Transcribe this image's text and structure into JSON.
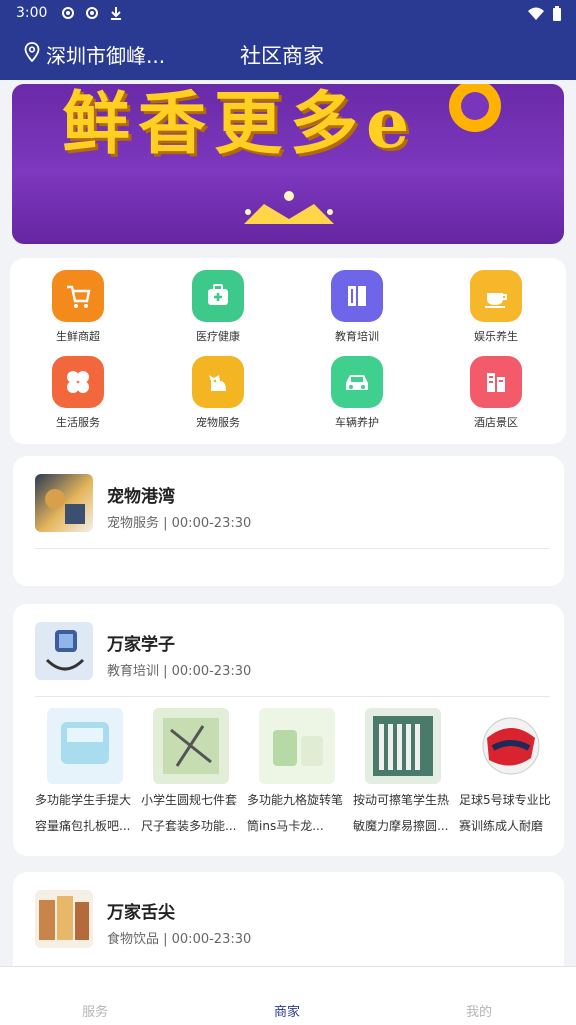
{
  "status": {
    "time": "3:00"
  },
  "header": {
    "location": "深圳市御峰...",
    "title": "社区商家"
  },
  "banner": {
    "text": "鲜香更多e"
  },
  "categories": [
    {
      "label": "生鲜商超",
      "icon": "shopping-cart-icon",
      "color": "#f48a1c"
    },
    {
      "label": "医疗健康",
      "icon": "medical-kit-icon",
      "color": "#3cc98a"
    },
    {
      "label": "教育培训",
      "icon": "book-icon",
      "color": "#6f65e8"
    },
    {
      "label": "娱乐养生",
      "icon": "coffee-cup-icon",
      "color": "#f6b72a"
    },
    {
      "label": "生活服务",
      "icon": "clover-icon",
      "color": "#f2673c"
    },
    {
      "label": "宠物服务",
      "icon": "dog-icon",
      "color": "#f3b521"
    },
    {
      "label": "车辆养护",
      "icon": "car-icon",
      "color": "#3fcf8e"
    },
    {
      "label": "酒店景区",
      "icon": "building-icon",
      "color": "#f45b6a"
    }
  ],
  "stores": [
    {
      "name": "宠物港湾",
      "meta": "宠物服务 | 00:00-23:30"
    },
    {
      "name": "万家学子",
      "meta": "教育培训 | 00:00-23:30",
      "products": [
        {
          "line1": "多功能学生手提大",
          "line2": "容量痛包扎板吧..."
        },
        {
          "line1": "小学生圆规七件套",
          "line2": "尺子套装多功能..."
        },
        {
          "line1": "多功能九格旋转笔",
          "line2": "筒ins马卡龙..."
        },
        {
          "line1": "按动可擦笔学生热",
          "line2": "敏魔力摩易擦圆..."
        },
        {
          "line1": "足球5号球专业比",
          "line2": "赛训练成人耐磨"
        }
      ]
    },
    {
      "name": "万家舌尖",
      "meta": "食物饮品 | 00:00-23:30"
    }
  ],
  "nav": {
    "service": "服务",
    "merchant": "商家",
    "mine": "我的"
  }
}
